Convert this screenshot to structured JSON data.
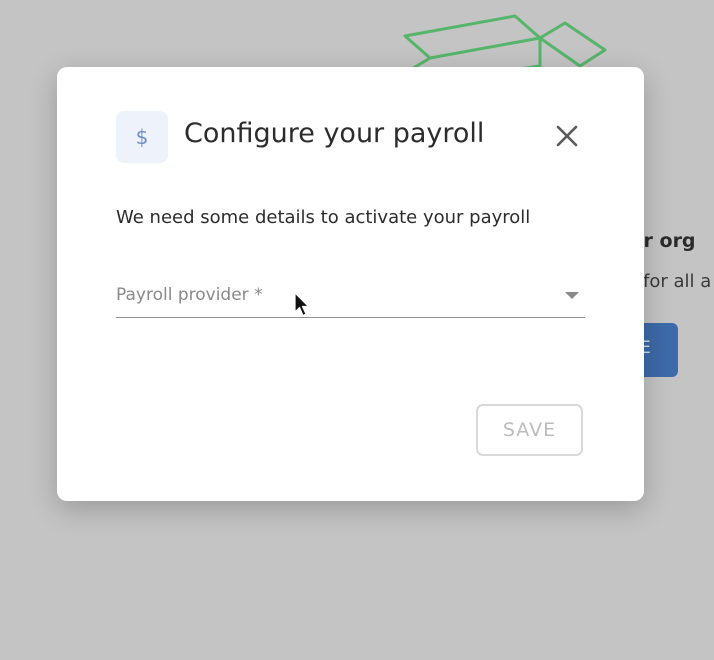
{
  "background": {
    "heading_fragment": "ur org",
    "subtext_fragment": "for all a",
    "button_fragment": "E",
    "button_color": "#3d6aa8",
    "illustration": "open-box-illustration",
    "illustration_color": "#56b56a"
  },
  "modal": {
    "icon_symbol": "$",
    "title": "Configure your payroll",
    "close_icon": "close-icon",
    "description": "We need some details to activate your payroll",
    "payroll_provider": {
      "placeholder": "Payroll provider *",
      "value": ""
    },
    "save_label": "SAVE"
  },
  "accent_color": "#6d8fc9"
}
